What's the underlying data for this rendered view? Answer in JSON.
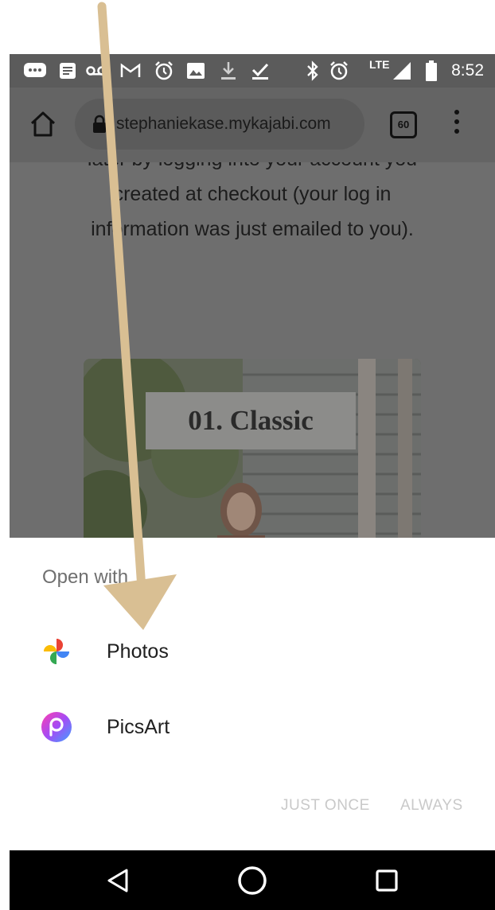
{
  "status_bar": {
    "time": "8:52",
    "network": "LTE",
    "icons": [
      "messages-icon",
      "notes-icon",
      "voicemail-icon",
      "gmail-icon",
      "alarm-icon",
      "image-icon",
      "download-icon",
      "check-icon",
      "bluetooth-icon",
      "alarm-icon",
      "signal-icon",
      "battery-icon"
    ]
  },
  "browser": {
    "url": "stephaniekase.mykajabi.com",
    "tab_count": "60"
  },
  "page": {
    "lines": [
      "later by logging into your account you",
      "created at checkout (your log in",
      "information was just emailed to you)."
    ],
    "image_caption": "01. Classic"
  },
  "sheet": {
    "title": "Open with",
    "apps": [
      {
        "label": "Photos",
        "icon": "google-photos-icon"
      },
      {
        "label": "PicsArt",
        "icon": "picsart-icon"
      }
    ],
    "just_once": "JUST ONCE",
    "always": "ALWAYS"
  },
  "annotation": {
    "arrow_color": "#d9bf93"
  }
}
